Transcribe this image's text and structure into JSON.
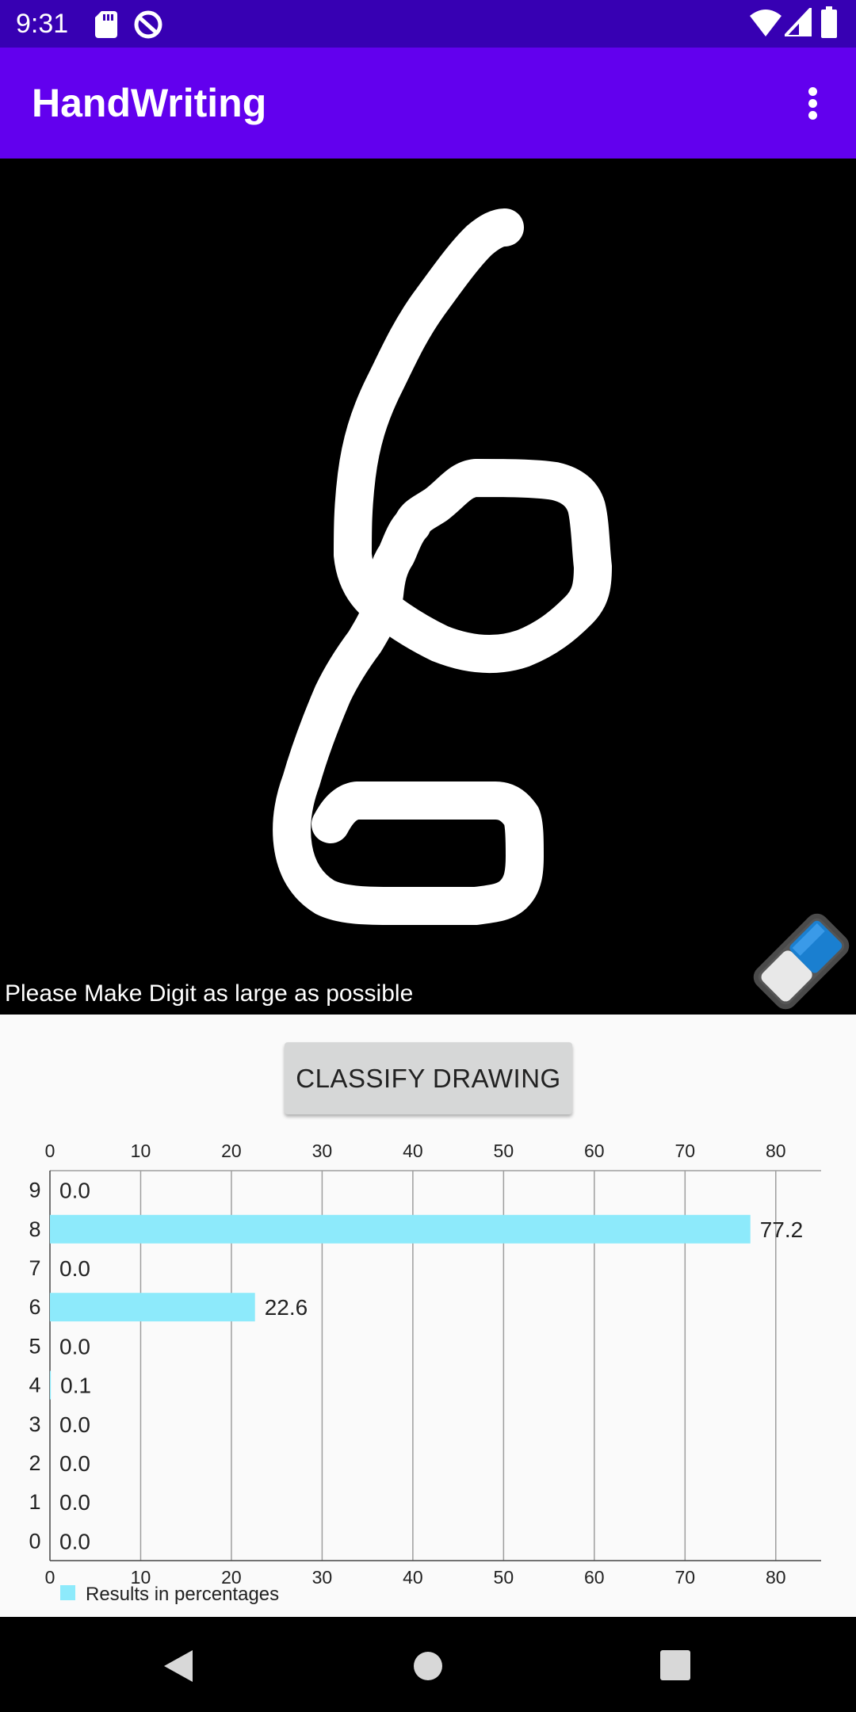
{
  "status_bar": {
    "time": "9:31"
  },
  "app_bar": {
    "title": "HandWriting"
  },
  "canvas": {
    "hint": "Please Make Digit as large as possible"
  },
  "classify_button": {
    "label": "CLASSIFY DRAWING"
  },
  "colors": {
    "bar": "#8deafb",
    "app_bar": "#6200ee",
    "status_bar": "#3700b3"
  },
  "chart_data": {
    "type": "bar",
    "orientation": "horizontal",
    "categories": [
      "9",
      "8",
      "7",
      "6",
      "5",
      "4",
      "3",
      "2",
      "1",
      "0"
    ],
    "series": [
      {
        "name": "Results in percentages",
        "values": [
          0.0,
          77.2,
          0.0,
          22.6,
          0.0,
          0.1,
          0.0,
          0.0,
          0.0,
          0.0
        ]
      }
    ],
    "value_labels": [
      "0.0",
      "77.2",
      "0.0",
      "22.6",
      "0.0",
      "0.1",
      "0.0",
      "0.0",
      "0.0",
      "0.0"
    ],
    "xlim": [
      0,
      85
    ],
    "xticks": [
      0,
      10,
      20,
      30,
      40,
      50,
      60,
      70,
      80
    ],
    "grid": true,
    "axis_position": "top and bottom",
    "legend": "bottom-left"
  }
}
